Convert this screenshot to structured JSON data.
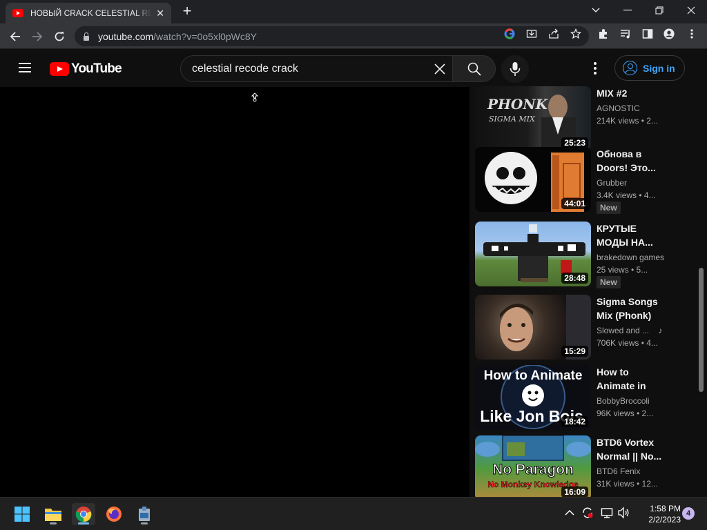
{
  "browser": {
    "tab_title": "НОВЫЙ CRACK CELESTIAL RECODE",
    "tab_close": "✕",
    "new_tab": "+",
    "url_host": "youtube.com",
    "url_path": "/watch?v=0o5xl0pWc8Y"
  },
  "youtube": {
    "logo_text": "YouTube",
    "search_value": "celestial recode crack",
    "signin_label": "Sign in"
  },
  "recommendations": [
    {
      "title": "MIX #2",
      "channel": "AGNOSTIC",
      "stats": "214K views • 2...",
      "duration": "25:23",
      "badge": "",
      "thumb_text_1": "PHONK",
      "thumb_text_2": "SIGMA MIX"
    },
    {
      "title": "Обнова в Doors! Это...",
      "channel": "Grubber",
      "stats": "3.4K views • 4...",
      "duration": "44:01",
      "badge": "New"
    },
    {
      "title": "КРУТЫЕ МОДЫ НА...",
      "channel": "brakedown games",
      "stats": "25 views • 5...",
      "duration": "28:48",
      "badge": "New"
    },
    {
      "title": "Sigma Songs Mix (Phonk)",
      "channel": "Slowed and ...",
      "channel_icon": "music-note-icon",
      "stats": "706K views • 4...",
      "duration": "15:29",
      "badge": ""
    },
    {
      "title": "How to Animate in Google Eart...",
      "channel": "BobbyBroccoli",
      "stats": "96K views • 2...",
      "duration": "18:42",
      "badge": "",
      "thumb_text_1": "How to Animate",
      "thumb_text_2": "Like Jon Bois"
    },
    {
      "title": "BTD6 Vortex Normal || No...",
      "channel": "BTD6 Fenix",
      "stats": "31K views • 12...",
      "duration": "16:09",
      "badge": "",
      "thumb_text_1": "No Paragon",
      "thumb_text_2": "No Monkey Knowledge"
    }
  ],
  "taskbar": {
    "time": "1:58 PM",
    "date": "2/2/2023",
    "notification_count": "4"
  },
  "colors": {
    "youtube_red": "#ff0000",
    "signin_blue": "#3ea6ff",
    "page_bg": "#0f0f0f"
  }
}
